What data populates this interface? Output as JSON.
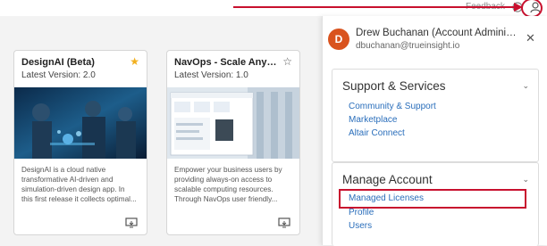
{
  "header": {
    "feedback_label": "Feedback"
  },
  "cards": [
    {
      "title": "DesignAI (Beta)",
      "version": "Latest Version: 2.0",
      "starred": true,
      "description": [
        "DesignAI is a cloud native",
        "transformative AI-driven and",
        "simulation-driven design app. In",
        "this first release it collects optimal..."
      ]
    },
    {
      "title": "NavOps - Scale Anywhe...",
      "version": "Latest Version: 1.0",
      "starred": false,
      "description": [
        "Empower your business users by",
        "providing always-on access to",
        "scalable computing resources.",
        "Through NavOps user friendly..."
      ]
    }
  ],
  "profile_panel": {
    "avatar_initial": "D",
    "name": "Drew Buchanan (Account Administrator)",
    "email": "dbuchanan@trueinsight.io",
    "support_section": {
      "title": "Support & Services",
      "links": [
        "Community & Support",
        "Marketplace",
        "Altair Connect"
      ]
    },
    "account_section": {
      "title": "Manage Account",
      "links": [
        "Managed Licenses",
        "Profile",
        "Users"
      ]
    }
  },
  "colors": {
    "accent_link": "#2a6ebb",
    "avatar_bg": "#d9531e",
    "annotation_red": "#c8102e",
    "star_gold": "#f2b01e"
  }
}
